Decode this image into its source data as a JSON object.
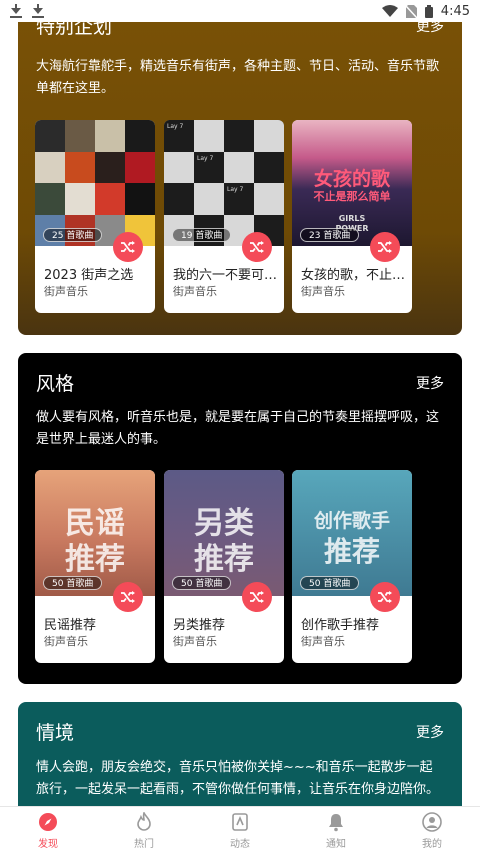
{
  "status": {
    "time": "4:45"
  },
  "sections": {
    "special": {
      "title": "特别企划",
      "more": "更多",
      "desc": "大海航行靠舵手，精选音乐有街声，各种主题、节日、活动、音乐节歌单都在这里。",
      "cards": [
        {
          "title": "2023 街声之选",
          "sub": "街声音乐",
          "count": "25 首歌曲"
        },
        {
          "title": "我的六一不要可…",
          "sub": "街声音乐",
          "count": "19 首歌曲",
          "cover_text": "Lay 7"
        },
        {
          "title": "女孩的歌，不止…",
          "sub": "街声音乐",
          "count": "23 首歌曲",
          "cover_line1": "女孩的歌",
          "cover_line2": "不止是那么简单",
          "cover_line3": "GIRLS",
          "cover_line4": "POWER"
        }
      ]
    },
    "style": {
      "title": "风格",
      "more": "更多",
      "desc": "做人要有风格，听音乐也是，就是要在属于自己的节奏里摇摆呼吸，这是世界上最迷人的事。",
      "cards": [
        {
          "title": "民谣推荐",
          "sub": "街声音乐",
          "count": "50 首歌曲",
          "line1": "民谣",
          "line2": "推荐"
        },
        {
          "title": "另类推荐",
          "sub": "街声音乐",
          "count": "50 首歌曲",
          "line1": "另类",
          "line2": "推荐"
        },
        {
          "title": "创作歌手推荐",
          "sub": "街声音乐",
          "count": "50 首歌曲",
          "line1": "创作歌手",
          "line2": "推荐"
        }
      ]
    },
    "mood": {
      "title": "情境",
      "more": "更多",
      "desc": "情人会跑，朋友会绝交，音乐只怕被你关掉~~~和音乐一起散步一起旅行，一起发呆一起看雨，不管你做任何事情，让音乐在你身边陪你。"
    }
  },
  "nav": [
    {
      "label": "发现",
      "icon": "compass-icon",
      "active": true
    },
    {
      "label": "热门",
      "icon": "flame-icon"
    },
    {
      "label": "动态",
      "icon": "feed-icon"
    },
    {
      "label": "通知",
      "icon": "bell-icon"
    },
    {
      "label": "我的",
      "icon": "user-icon"
    }
  ],
  "colors": {
    "accent": "#f44b58",
    "special_bg": "#7a5206",
    "style_bg": "#000000",
    "mood_bg": "#0b5c5c"
  }
}
